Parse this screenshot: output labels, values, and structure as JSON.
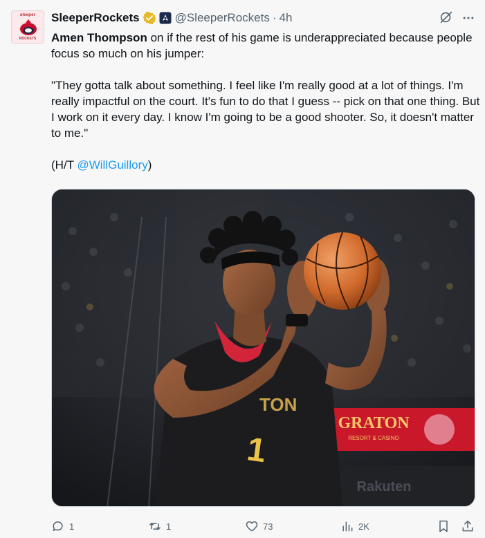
{
  "tweet": {
    "author_name": "SleeperRockets",
    "handle": "@SleeperRockets",
    "separator": "·",
    "time": "4h",
    "avatar_text_top": "sleeper",
    "avatar_text_bottom": "ROCKETS",
    "text": {
      "mention": "Amen Thompson",
      "line1_rest": " on if the rest of his game is underappreciated because people focus so much on his jumper:",
      "quote": "\"They gotta talk about something. I feel like I'm really good at a lot of things. I'm really impactful on the court. It's fun to do that I guess -- pick on that one thing. But I work on it every day. I know I'm going to be a good shooter. So, it doesn't matter to me.\"",
      "ht_prefix": "(H/T ",
      "ht_link": "@WillGuillory",
      "ht_suffix": ")"
    },
    "media": {
      "jersey_number": "1",
      "banner_text": "GRATON",
      "banner_subtext": "RESORT & CASINO",
      "sign_text": "Rakuten",
      "jersey_text": "TON"
    },
    "actions": {
      "replies": "1",
      "reposts": "1",
      "likes": "73",
      "views": "2K"
    }
  },
  "colors": {
    "text_primary": "#0f1419",
    "text_secondary": "#536471",
    "link": "#1d9bf0",
    "verified_gold": "#e8b829",
    "background": "#f7f7f7"
  },
  "icons": {
    "verified": "verified-gold-badge-icon",
    "affiliate": "rockets-affiliate-badge-icon",
    "grok": "grok-icon",
    "more": "more-dots-icon",
    "reply": "reply-icon",
    "repost": "repost-icon",
    "like": "heart-icon",
    "views": "views-chart-icon",
    "bookmark": "bookmark-icon",
    "share": "share-icon"
  }
}
